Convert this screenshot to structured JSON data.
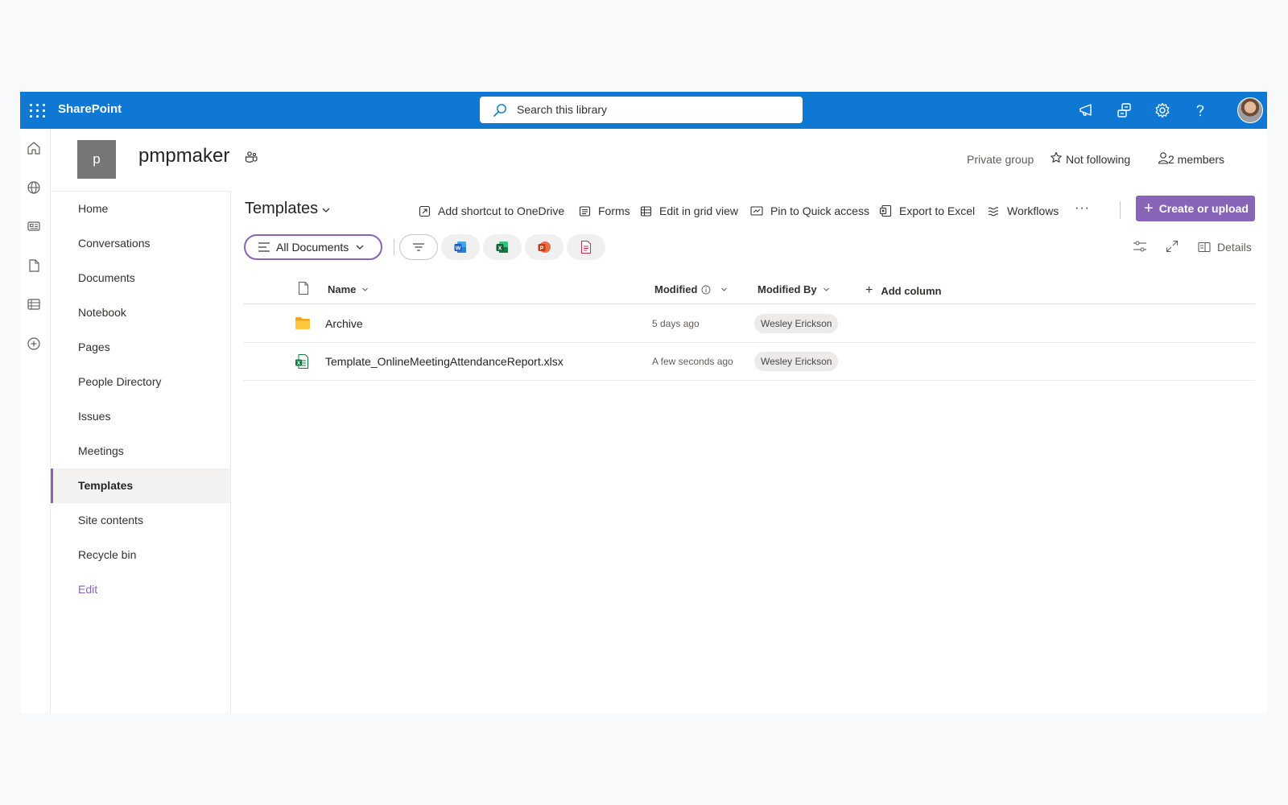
{
  "suitebar": {
    "app_name": "SharePoint",
    "search_placeholder": "Search this library",
    "colors": {
      "bar": "#0f78d4",
      "accent": "#8764b8"
    }
  },
  "site": {
    "logo_letter": "p",
    "title": "pmpmaker",
    "privacy": "Private group",
    "follow_label": "Not following",
    "members_label": "2 members"
  },
  "quick_launch": {
    "items": [
      {
        "label": "Home"
      },
      {
        "label": "Conversations"
      },
      {
        "label": "Documents"
      },
      {
        "label": "Notebook"
      },
      {
        "label": "Pages"
      },
      {
        "label": "People Directory"
      },
      {
        "label": "Issues"
      },
      {
        "label": "Meetings"
      },
      {
        "label": "Templates"
      },
      {
        "label": "Site contents"
      },
      {
        "label": "Recycle bin"
      },
      {
        "label": "Edit"
      }
    ],
    "selected": "Templates"
  },
  "library": {
    "title": "Templates",
    "commands": {
      "add_shortcut": "Add shortcut to OneDrive",
      "forms": "Forms",
      "grid_view": "Edit in grid view",
      "pin": "Pin to Quick access",
      "export": "Export to Excel",
      "workflows": "Workflows",
      "more": "···",
      "create": "Create or upload"
    },
    "view": "All Documents",
    "details_label": "Details"
  },
  "columns": {
    "name": "Name",
    "modified": "Modified",
    "modified_by": "Modified By",
    "add_column": "Add column"
  },
  "files": [
    {
      "name": "Archive",
      "type": "folder-icon",
      "modified": "5 days ago",
      "modified_by": "Wesley Erickson"
    },
    {
      "name": "Template_OnlineMeetingAttendanceReport.xlsx",
      "type": "excel-file-icon",
      "modified": "A few seconds ago",
      "modified_by": "Wesley Erickson"
    }
  ]
}
